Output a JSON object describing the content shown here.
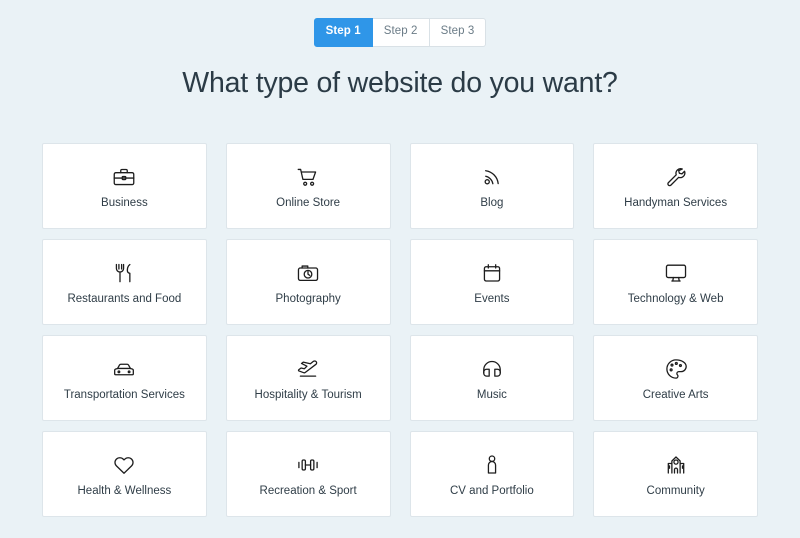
{
  "steps": {
    "items": [
      {
        "label": "Step 1",
        "active": true
      },
      {
        "label": "Step 2",
        "active": false
      },
      {
        "label": "Step 3",
        "active": false
      }
    ]
  },
  "heading": {
    "title": "What type of website do you want?"
  },
  "colors": {
    "page_background": "#eaf2f6",
    "card_background": "#ffffff",
    "card_border": "#dde5ea",
    "active_step": "#2f96e8",
    "text": "#2f3d47"
  },
  "categories": [
    {
      "label": "Business",
      "icon": "briefcase-icon"
    },
    {
      "label": "Online Store",
      "icon": "shopping-cart-icon"
    },
    {
      "label": "Blog",
      "icon": "rss-feed-icon"
    },
    {
      "label": "Handyman Services",
      "icon": "wrench-icon"
    },
    {
      "label": "Restaurants and Food",
      "icon": "fork-and-knife-icon"
    },
    {
      "label": "Photography",
      "icon": "camera-icon"
    },
    {
      "label": "Events",
      "icon": "calendar-icon"
    },
    {
      "label": "Technology & Web",
      "icon": "monitor-icon"
    },
    {
      "label": "Transportation Services",
      "icon": "car-icon"
    },
    {
      "label": "Hospitality & Tourism",
      "icon": "airplane-takeoff-icon"
    },
    {
      "label": "Music",
      "icon": "headphones-icon"
    },
    {
      "label": "Creative Arts",
      "icon": "paint-palette-icon"
    },
    {
      "label": "Health & Wellness",
      "icon": "heart-icon"
    },
    {
      "label": "Recreation & Sport",
      "icon": "dumbbell-icon"
    },
    {
      "label": "CV and Portfolio",
      "icon": "person-icon"
    },
    {
      "label": "Community",
      "icon": "town-hall-icon"
    }
  ]
}
